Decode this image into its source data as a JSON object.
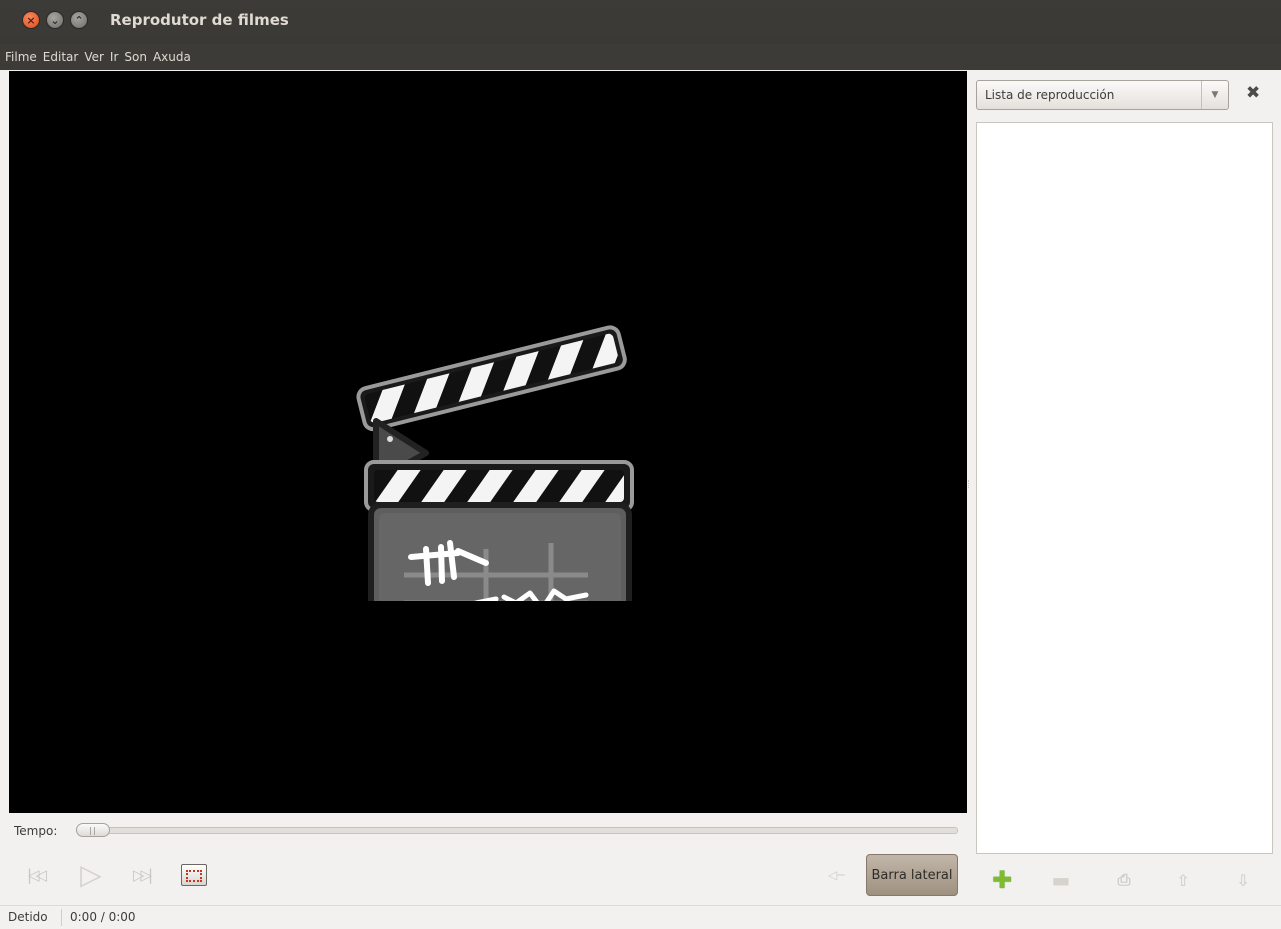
{
  "window": {
    "title": "Reprodutor de filmes"
  },
  "menu": [
    "Filme",
    "Editar",
    "Ver",
    "Ir",
    "Son",
    "Axuda"
  ],
  "seek": {
    "label": "Tempo:",
    "progress": 0
  },
  "controls": {
    "prev_icon": "previous-track-icon",
    "play_icon": "play-icon",
    "next_icon": "next-track-icon",
    "fullscreen_icon": "fullscreen-icon",
    "volume_icon": "volume-icon",
    "sidebar_button": "Barra lateral"
  },
  "status": {
    "state": "Detido",
    "time": "0:00 / 0:00"
  },
  "sidebar": {
    "selector_value": "Lista de reproducción",
    "close_icon": "close-icon",
    "buttons": [
      "add-icon",
      "remove-icon",
      "save-icon",
      "up-arrow-icon",
      "down-arrow-icon"
    ]
  },
  "colors": {
    "titlebar": "#3c3b37",
    "video_bg": "#000000",
    "close_button": "#df4a16",
    "add_button": "#7dbb2f"
  }
}
